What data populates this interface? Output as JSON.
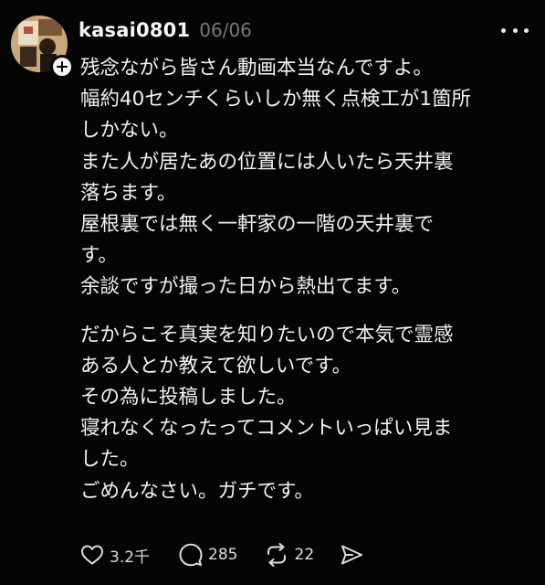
{
  "post": {
    "username": "kasai0801",
    "date": "06/06",
    "lines_part1": [
      "残念ながら皆さん動画本当なんですよ。",
      "幅約40センチくらいしか無く点検工が1箇所",
      "しかない。",
      "また人が居たあの位置には人いたら天井裏",
      "落ちます。",
      "屋根裏では無く一軒家の一階の天井裏で",
      "す。",
      "余談ですが撮った日から熱出てます。"
    ],
    "lines_part2": [
      "だからこそ真実を知りたいので本気で霊感",
      "ある人とか教えて欲しいです。",
      "その為に投稿しました。",
      "寝れなくなったってコメントいっぱい見ま",
      "した。",
      "ごめんなさい。ガチです。"
    ],
    "actions": {
      "likes": "3.2千",
      "replies": "285",
      "reposts": "22"
    }
  },
  "icons": {
    "avatar": "profile-photo",
    "follow": "plus-icon",
    "more": "more-horizontal-icon",
    "like": "heart-icon",
    "reply": "comment-bubble-icon",
    "repost": "repost-arrows-icon",
    "share": "send-icon"
  }
}
